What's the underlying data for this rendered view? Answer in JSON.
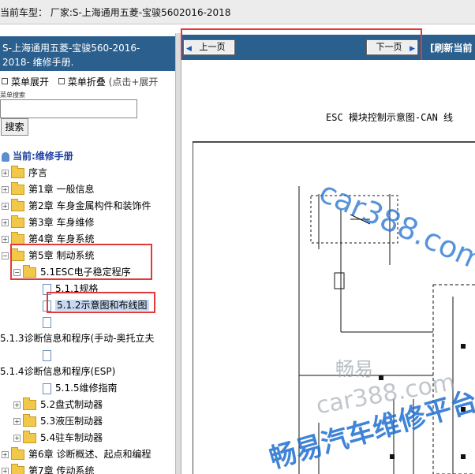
{
  "window": {
    "title": "当前车型：  厂家:S-上海通用五菱-宝骏5602016-2018"
  },
  "sidebar": {
    "header_line1": "S-上海通用五菱-宝骏560-2016-",
    "header_line2": "2018- 维修手册.",
    "expand_label": "菜单展开",
    "collapse_label": "菜单折叠",
    "collapse_hint": "(点击+展开",
    "search_label": "菜单搜索",
    "search_value": "",
    "search_button": "搜索",
    "current_label": "当前:维修手册",
    "tree": [
      {
        "label": "序言"
      },
      {
        "label": "第1章 一般信息"
      },
      {
        "label": "第2章 车身金属构件和装饰件"
      },
      {
        "label": "第3章 车身维修"
      },
      {
        "label": "第4章 车身系统"
      },
      {
        "label": "第5章 制动系统"
      },
      {
        "label": "5.1ESC电子稳定程序"
      },
      {
        "label": "5.1.1规格"
      },
      {
        "label": "5.1.2示意图和布线图"
      },
      {
        "label": ""
      },
      {
        "label": "5.1.3诊断信息和程序(手动-奥托立夫"
      },
      {
        "label": ""
      },
      {
        "label": "5.1.4诊断信息和程序(ESP)"
      },
      {
        "label": "5.1.5维修指南"
      },
      {
        "label": "5.2盘式制动器"
      },
      {
        "label": "5.3液压制动器"
      },
      {
        "label": "5.4驻车制动器"
      },
      {
        "label": "第6章 诊断概述、起点和编程"
      },
      {
        "label": "第7章 传动系统"
      }
    ]
  },
  "nav": {
    "prev_label": "上一页",
    "next_label": "下一页",
    "refresh_label": "[刷新当前"
  },
  "viewer": {
    "doc_title": "ESC 模块控制示意图-CAN 线",
    "watermarks": [
      "car388.com",
      "畅易",
      "car388.com",
      "畅易汽车维修平台"
    ]
  },
  "colors": {
    "header_blue": "#2b5f8e",
    "highlight_red": "#e23a3a",
    "watermark_blue": "#1f6fd1"
  }
}
